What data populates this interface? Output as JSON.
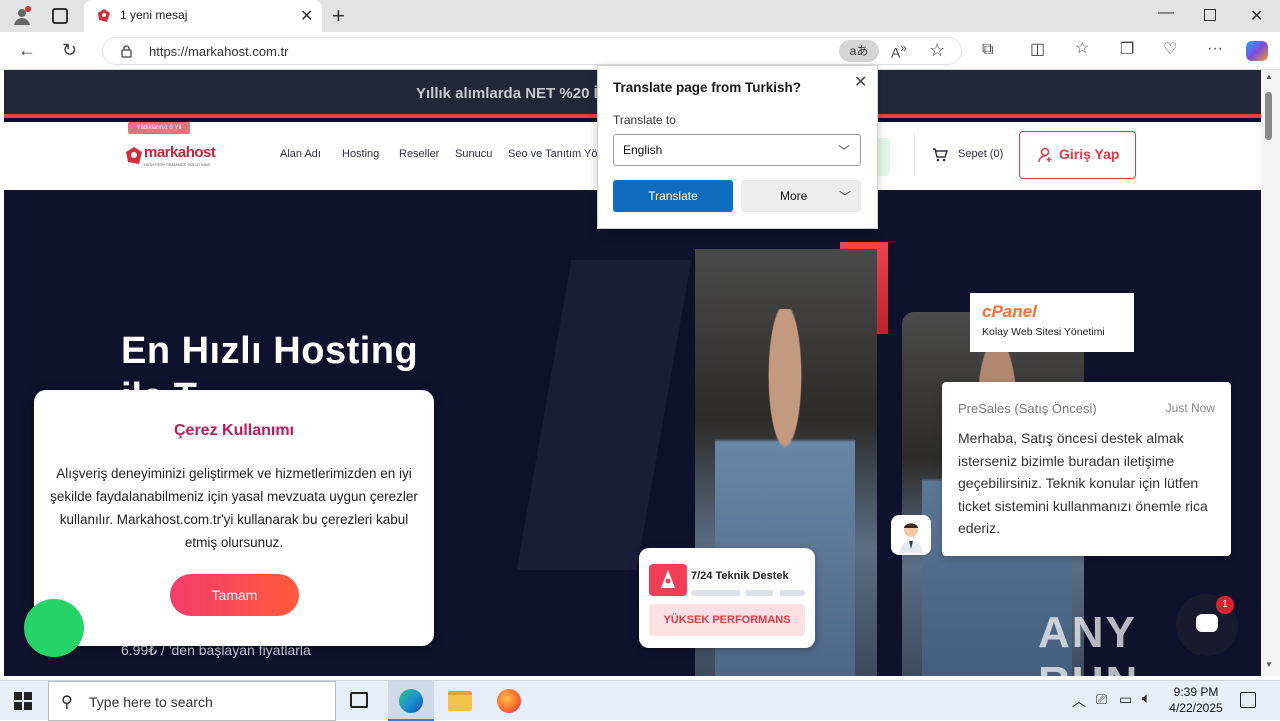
{
  "browser": {
    "tab_title": "1 yeni mesaj",
    "url": "https://markahost.com.tr"
  },
  "site": {
    "promo": "Yıllık alımlarda NET %20 İ",
    "logo_badge": "Yıldıklarınız 6 Yıl",
    "logo": "markahost",
    "logo_tagline": "HIGH PERFORMANCE SOLUTIONS",
    "nav": [
      "Alan Adı",
      "Hosting",
      "Reseller",
      "Sunucu",
      "Seo ve Tanıtım Yö"
    ],
    "cart": "Sepet (0)",
    "login": "Giriş Yap",
    "hero_title": "En Hızlı Hosting",
    "hero_title_line2": "ile T",
    "hero_sub": "6.99₺ / 'den başlayan fiyatlarla",
    "cpanel_logo": "cPanel",
    "cpanel_text": "Kolay Web Sitesi Yönetimi",
    "support_title": "7/24 Teknik Destek",
    "support_badge": "YÜKSEK PERFORMANS"
  },
  "cookie": {
    "title": "Çerez Kullanımı",
    "body": "Alışveriş deneyiminizi geliştirmek ve hizmetlerimizden en iyi şekilde faydalanabilmeniz için yasal mevzuata uygun çerezler kullanılır. Markahost.com.tr'yi kullanarak bu çerezleri kabul etmiş olursunuz.",
    "button": "Tamam"
  },
  "translate": {
    "title": "Translate page from Turkish?",
    "label": "Translate to",
    "selected": "English",
    "translate_btn": "Translate",
    "more_btn": "More"
  },
  "chat": {
    "agent": "PreSales (Satış Öncesi)",
    "time": "Just Now",
    "message": "Merhaba, Satış öncesi destek almak isterseniz bizimle buradan iletişime geçebilirsiniz. Teknik konular için lütfen ticket sistemini kullanmanızı önemle rica ederiz.",
    "unread_count": "1"
  },
  "watermark": "ANY RUN",
  "taskbar": {
    "search_placeholder": "Type here to search",
    "time": "9:39 PM",
    "date": "4/22/2025"
  }
}
